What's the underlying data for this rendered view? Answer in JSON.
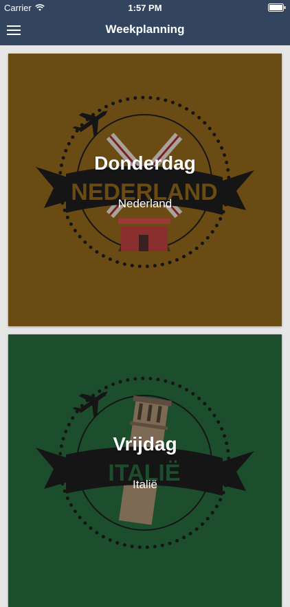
{
  "status": {
    "carrier": "Carrier",
    "time": "1:57 PM"
  },
  "nav": {
    "title": "Weekplanning"
  },
  "cards": [
    {
      "day": "Donderdag",
      "country": "Nederland",
      "badge": "NEDERLAND",
      "bg": "#6b4b14"
    },
    {
      "day": "Vrijdag",
      "country": "Italië",
      "badge": "ITALIË",
      "bg": "#1c4e2e"
    }
  ],
  "icons": {
    "menu": "hamburger-menu-icon",
    "plane": "airplane-icon",
    "wifi": "wifi-icon",
    "battery": "battery-icon"
  }
}
